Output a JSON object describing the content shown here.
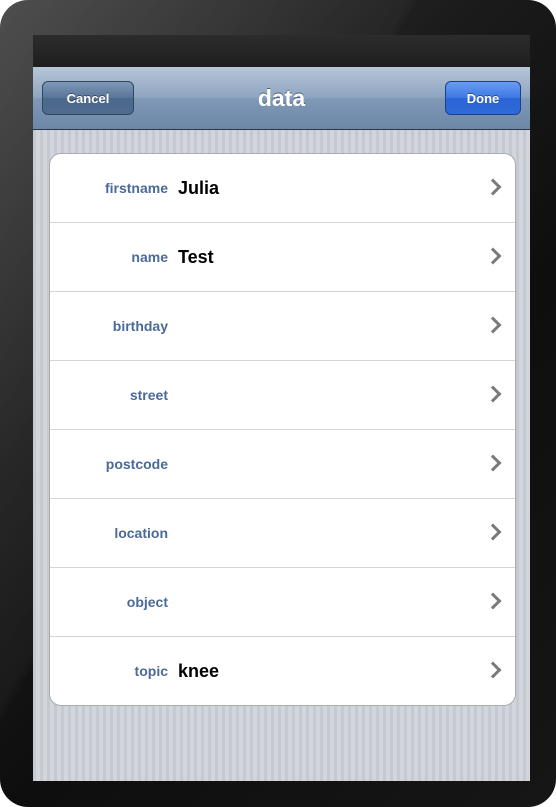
{
  "navbar": {
    "title": "data",
    "cancel_label": "Cancel",
    "done_label": "Done"
  },
  "rows": [
    {
      "label": "firstname",
      "value": "Julia",
      "icon": "chevron-right-icon"
    },
    {
      "label": "name",
      "value": "Test",
      "icon": "chevron-right-icon"
    },
    {
      "label": "birthday",
      "value": "",
      "icon": "chevron-right-icon"
    },
    {
      "label": "street",
      "value": "",
      "icon": "chevron-right-icon"
    },
    {
      "label": "postcode",
      "value": "",
      "icon": "chevron-right-icon"
    },
    {
      "label": "location",
      "value": "",
      "icon": "chevron-right-icon"
    },
    {
      "label": "object",
      "value": "",
      "icon": "chevron-right-icon"
    },
    {
      "label": "topic",
      "value": "knee",
      "icon": "chevron-right-icon"
    }
  ],
  "colors": {
    "nav_bar": "#8fa6c1",
    "done_button": "#3d78e3",
    "cancel_button": "#587597",
    "label_text": "#4b6a98",
    "background": "#c9ccd3"
  }
}
